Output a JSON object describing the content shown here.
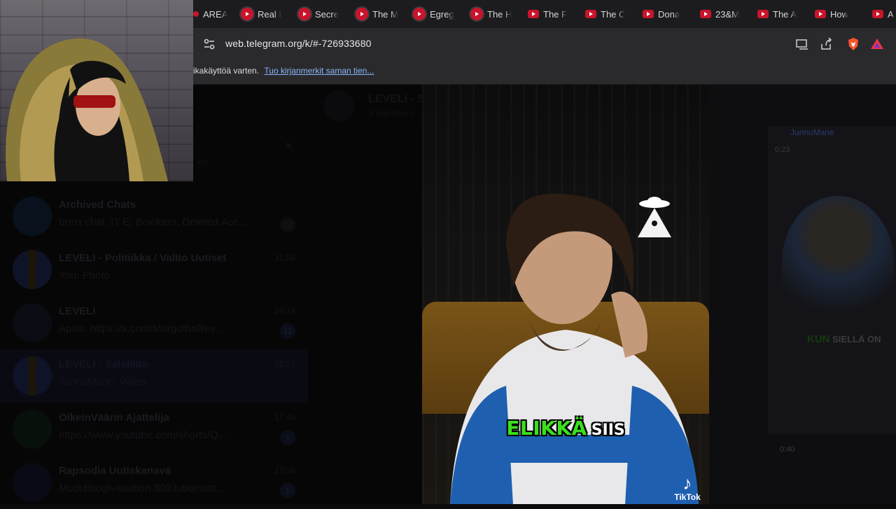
{
  "browser": {
    "tabs": [
      {
        "title": "AREA",
        "icon": "dot-icon"
      },
      {
        "title": "Real I",
        "icon": "youtube-icon"
      },
      {
        "title": "Secre",
        "icon": "youtube-icon"
      },
      {
        "title": "The M",
        "icon": "youtube-icon"
      },
      {
        "title": "Egreg",
        "icon": "youtube-icon"
      },
      {
        "title": "The H",
        "icon": "youtube-icon"
      },
      {
        "title": "The F",
        "icon": "youtube-icon"
      },
      {
        "title": "The C",
        "icon": "youtube-icon"
      },
      {
        "title": "Dona",
        "icon": "youtube-icon"
      },
      {
        "title": "23&M",
        "icon": "youtube-icon"
      },
      {
        "title": "The A",
        "icon": "youtube-icon"
      },
      {
        "title": "How",
        "icon": "youtube-icon"
      },
      {
        "title": "A",
        "icon": "youtube-icon"
      }
    ],
    "url": "web.telegram.org/k/#-726933680",
    "bookmark_bar": {
      "text": "ikakäyttöä varten.",
      "link": "Tuo kirjanmerkit saman tien..."
    }
  },
  "telegram": {
    "header": {
      "title": "LEVELI - S",
      "subtitle": "3 members"
    },
    "search_placeholder": "es",
    "chats": [
      {
        "title": "Archived Chats",
        "preview": "brrrrr chat, IT E, Boinkers, Deleted Acc...",
        "time": "",
        "badge": "22"
      },
      {
        "title": "LEVELI - Politiikka / Valtio Uutiset",
        "preview": "You: Photo",
        "time": "11:56",
        "badge": ""
      },
      {
        "title": "LEVELI",
        "preview": "Apsis: https://x.com/MorgothsRev...",
        "time": "19:18",
        "badge": "11"
      },
      {
        "title": "LEVELI - Salaliitto",
        "preview": "JunnuMane: Video",
        "time": "18:27",
        "badge": ""
      },
      {
        "title": "OikeinVäärin Ajattelija",
        "preview": "https://www.youtube.com/shorts/Q...",
        "time": "17:45",
        "badge": "1"
      },
      {
        "title": "Rapsodia Uutiskanava",
        "preview": "Moduliough-saation 300 tutkimust...",
        "time": "17:36",
        "badge": "1"
      }
    ]
  },
  "video": {
    "caption_highlight": "ELIKKÄ",
    "caption_rest": "SIIS",
    "watermark": "TikTok"
  },
  "side_copy": {
    "sender": "JunnuMane",
    "time": "0:23",
    "caption_highlight": "KUN",
    "caption_rest": "SIELLÄ ON",
    "time2": "0:40"
  }
}
